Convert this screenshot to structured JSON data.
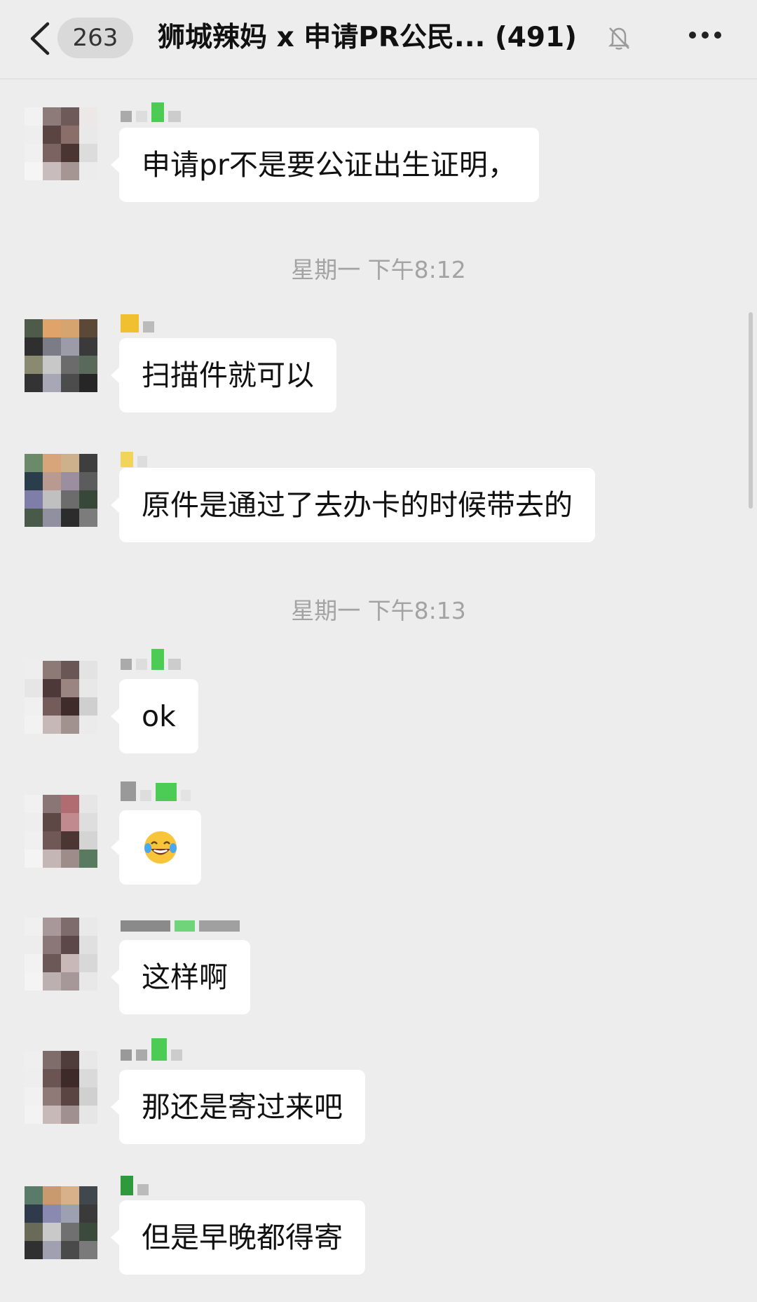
{
  "header": {
    "unread_count": "263",
    "title": "狮城辣妈 x 申请PR公民... (491)"
  },
  "icons": {
    "back": "back-arrow-icon",
    "mute": "mute-bell-icon",
    "more": "more-dots-icon"
  },
  "timestamps": [
    "星期一 下午8:12",
    "星期一 下午8:13"
  ],
  "messages": [
    {
      "text": "申请pr不是要公证出生证明，"
    },
    {
      "text": "扫描件就可以"
    },
    {
      "text": "原件是通过了去办卡的时候带去的"
    },
    {
      "text": "ok"
    },
    {
      "text": "",
      "emoji": "laughing-tears-emoji"
    },
    {
      "text": "这样啊"
    },
    {
      "text": "那还是寄过来吧"
    },
    {
      "text": "但是早晚都得寄"
    }
  ],
  "colors": {
    "background": "#ededed",
    "bubble": "#ffffff",
    "timestamp": "#a3a3a3",
    "nick_green": "#4ccb55"
  }
}
